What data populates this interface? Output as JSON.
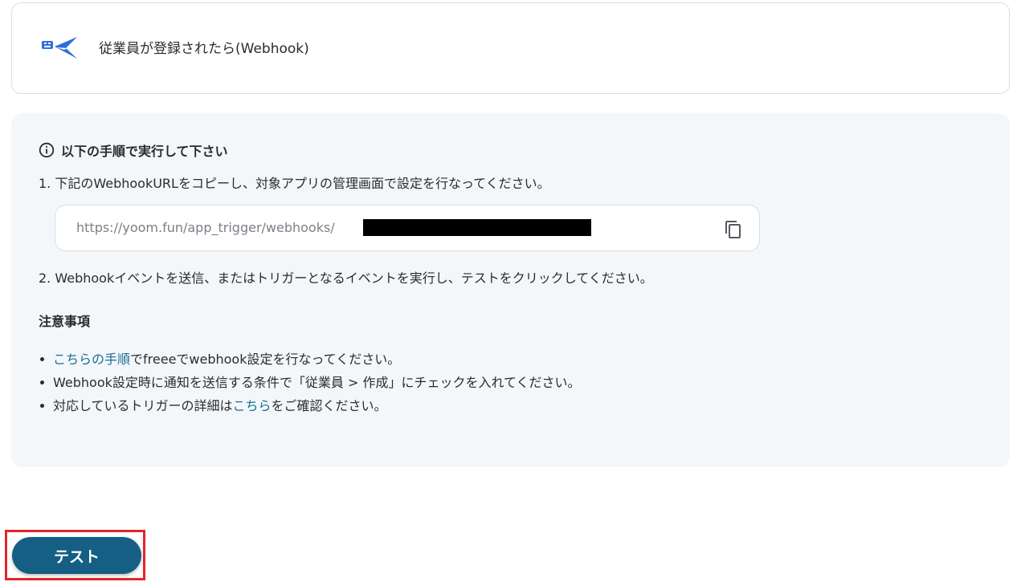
{
  "trigger": {
    "title": "従業員が登録されたら(Webhook)",
    "icon": "freee-bird-icon",
    "icon_color": "#2f6fd6"
  },
  "instructions": {
    "heading": "以下の手順で実行して下さい",
    "step1": "1. 下記のWebhookURLをコピーし、対象アプリの管理画面で設定を行なってください。",
    "webhook_url": "https://yoom.fun/app_trigger/webhooks/",
    "step2": "2. Webhookイベントを送信、またはトリガーとなるイベントを実行し、テストをクリックしてください。"
  },
  "notes": {
    "heading": "注意事項",
    "item1_link": "こちらの手順",
    "item1_text": "でfreeeでwebhook設定を行なってください。",
    "item2_text": "Webhook設定時に通知を送信する条件で「従業員 > 作成」にチェックを入れてください。",
    "item3_text_before": "対応しているトリガーの詳細は",
    "item3_link": "こちら",
    "item3_text_after": "をご確認ください。"
  },
  "actions": {
    "test_label": "テスト"
  },
  "colors": {
    "link": "#1a6e96",
    "primary_button": "#155f84",
    "highlight_border": "#e5252a",
    "panel_background": "#f4f7fa"
  }
}
